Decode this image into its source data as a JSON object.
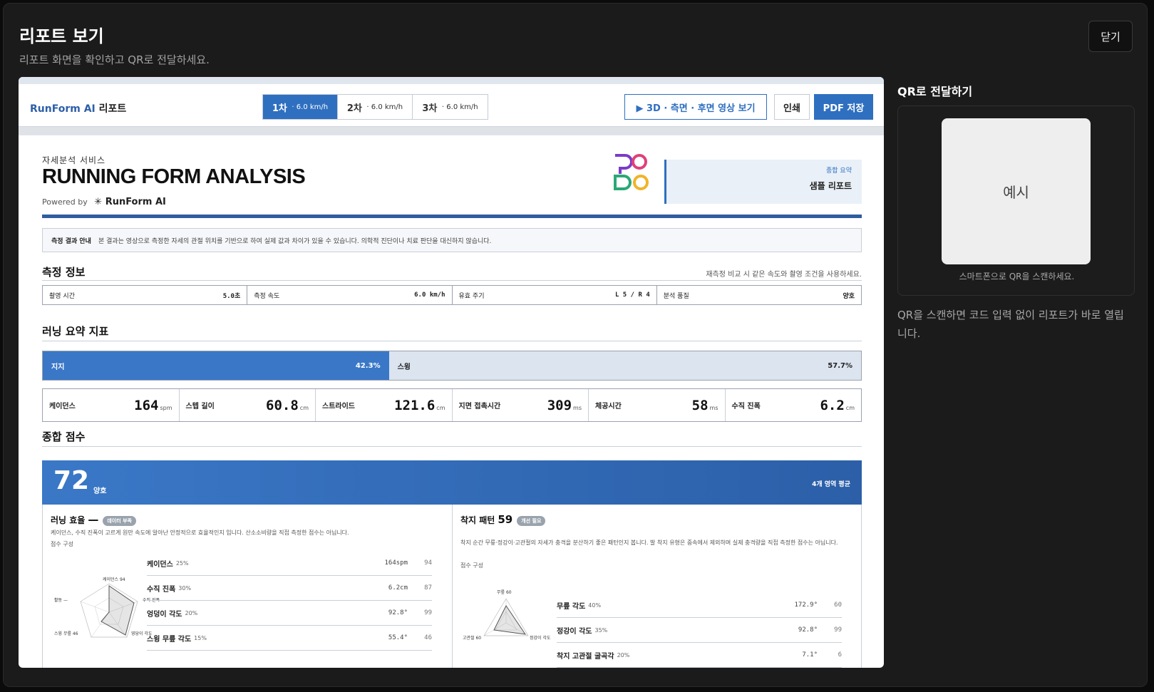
{
  "modal": {
    "title": "리포트 보기",
    "subtitle": "리포트 화면을 확인하고 QR로 전달하세요.",
    "close_label": "닫기"
  },
  "qr": {
    "title": "QR로 전달하기",
    "placeholder": "예시",
    "caption": "스마트폰으로 QR을 스캔하세요.",
    "description": "QR을 스캔하면 코드 입력 없이 리포트가 바로 열립니다."
  },
  "report": {
    "brand_en": "RunForm AI",
    "brand_ko": "리포트",
    "tabs": [
      {
        "label": "1차",
        "speed": "· 6.0 km/h",
        "active": true
      },
      {
        "label": "2차",
        "speed": "· 6.0 km/h",
        "active": false
      },
      {
        "label": "3차",
        "speed": "· 6.0 km/h",
        "active": false
      }
    ],
    "video_button": "▶ 3D · 측면 · 후면 영상 보기",
    "print_button": "인쇄",
    "pdf_button": "PDF 저장",
    "kicker": "자세분석 서비스",
    "title": "RUNNING FORM ANALYSIS",
    "powered_by": "Powered by",
    "powered_brand": "RunForm AI",
    "summary_label": "종합 요약",
    "summary_value": "샘플 리포트",
    "notice_title": "측정 결과 안내",
    "notice_text": "본 결과는 영상으로 측정한 자세의 관절 위치를 기반으로 하여 실제 값과 차이가 있을 수 있습니다. 의학적 진단이나 치료 판단을 대신하지 않습니다.",
    "measure_title": "측정 정보",
    "measure_note": "재측정 비교 시 같은 속도와 촬영 조건을 사용하세요.",
    "measures": [
      {
        "label": "촬영 시간",
        "value": "5.0초"
      },
      {
        "label": "측정 속도",
        "value": "6.0 km/h"
      },
      {
        "label": "유효 주기",
        "value": "L 5 / R 4"
      },
      {
        "label": "분석 품질",
        "value": "양호"
      }
    ],
    "summary_title": "러닝 요약 지표",
    "stance_label": "지지",
    "stance_pct": "42.3%",
    "stance_value": 42.3,
    "swing_label": "스윙",
    "swing_pct": "57.7%",
    "metrics": [
      {
        "label": "케이던스",
        "value": "164",
        "unit": "spm"
      },
      {
        "label": "스텝 길이",
        "value": "60.8",
        "unit": "cm"
      },
      {
        "label": "스트라이드",
        "value": "121.6",
        "unit": "cm"
      },
      {
        "label": "지면 접촉시간",
        "value": "309",
        "unit": "ms"
      },
      {
        "label": "체공시간",
        "value": "58",
        "unit": "ms"
      },
      {
        "label": "수직 진폭",
        "value": "6.2",
        "unit": "cm"
      }
    ],
    "score_title": "종합 점수",
    "score_value": "72",
    "score_grade": "양호",
    "score_avg_label": "4개 영역 평균",
    "efficiency": {
      "title": "러닝 효율",
      "score": "—",
      "pill": "데이터 부족",
      "desc": "케이던스, 수직 진폭이 고르게 원만 속도에 알아난 안정적으로 효율적인지 입니다. 산소소비량을 직접 측정한 점수는 아닙니다.",
      "comp_label": "점수 구성",
      "radar_labels": [
        "케이던스 94",
        "수직 진폭",
        "영당이 각도",
        "스윙 무릎 46",
        "활동 —"
      ],
      "factors": [
        {
          "name": "케이던스",
          "weight": "25%",
          "value": "164spm",
          "points": "94"
        },
        {
          "name": "수직 진폭",
          "weight": "30%",
          "value": "6.2cm",
          "points": "87"
        },
        {
          "name": "엉덩이 각도",
          "weight": "20%",
          "value": "92.8°",
          "points": "99"
        },
        {
          "name": "스윙 무릎 각도",
          "weight": "15%",
          "value": "55.4°",
          "points": "46"
        }
      ]
    },
    "landing": {
      "title": "착지 패턴",
      "score": "59",
      "pill": "개선 필요",
      "desc": "착지 순간 무릎·정강이·고관절의 자세가 충격을 분산하기 좋은 패턴인지 봅니다. 발 착지 유형은 중속에서 제외하며 실제 충격량을 직접 측정한 점수는 아닙니다.",
      "comp_label": "점수 구성",
      "radar_labels": [
        "무릎 60",
        "고관절 60",
        "정강이 각도"
      ],
      "factors": [
        {
          "name": "무릎 각도",
          "weight": "40%",
          "value": "172.9°",
          "points": "60"
        },
        {
          "name": "정강이 각도",
          "weight": "35%",
          "value": "92.8°",
          "points": "99"
        },
        {
          "name": "착지 고관절 굴곡각",
          "weight": "20%",
          "value": "7.1°",
          "points": "6"
        }
      ]
    }
  },
  "colors": {
    "accent": "#2f6fc0",
    "score_bg": "#3a78c7",
    "swing_bg": "#dbe4ef"
  }
}
